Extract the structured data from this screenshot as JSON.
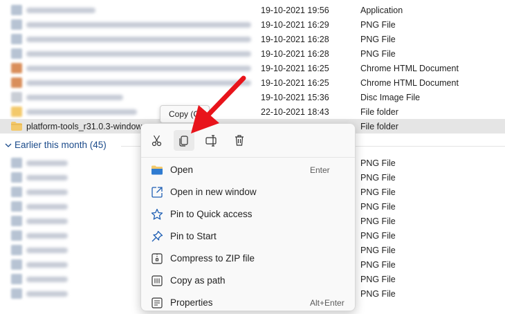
{
  "rows_top": [
    {
      "date": "19-10-2021 19:56",
      "type": "Application",
      "icon_color": "#b7c3d3",
      "text_w": 100
    },
    {
      "date": "19-10-2021 16:29",
      "type": "PNG File",
      "icon_color": "#b7c3d3",
      "text_w": 325
    },
    {
      "date": "19-10-2021 16:28",
      "type": "PNG File",
      "icon_color": "#b7c3d3",
      "text_w": 325
    },
    {
      "date": "19-10-2021 16:28",
      "type": "PNG File",
      "icon_color": "#b7c3d3",
      "text_w": 325
    },
    {
      "date": "19-10-2021 16:25",
      "type": "Chrome HTML Document",
      "icon_color": "#d98e5a",
      "text_w": 325
    },
    {
      "date": "19-10-2021 16:25",
      "type": "Chrome HTML Document",
      "icon_color": "#d98e5a",
      "text_w": 325
    },
    {
      "date": "19-10-2021 15:36",
      "type": "Disc Image File",
      "icon_color": "#c9ced6",
      "text_w": 140
    },
    {
      "date": "22-10-2021 18:43",
      "type": "File folder",
      "icon_color": "#f3c96b",
      "text_w": 160
    }
  ],
  "selected_row": {
    "name": "platform-tools_r31.0.3-windows",
    "type": "File folder"
  },
  "group": {
    "label": "Earlier this month (45)"
  },
  "rows_bottom": [
    {
      "type": "PNG File"
    },
    {
      "type": "PNG File"
    },
    {
      "type": "PNG File"
    },
    {
      "type": "PNG File"
    },
    {
      "type": "PNG File"
    },
    {
      "type": "PNG File"
    },
    {
      "type": "PNG File"
    },
    {
      "type": "PNG File"
    },
    {
      "type": "PNG File"
    },
    {
      "type": "PNG File"
    }
  ],
  "tooltip": {
    "text": "Copy (Ctrl+C)"
  },
  "context_menu": {
    "quick_actions": [
      "cut-icon",
      "copy-icon",
      "rename-icon",
      "delete-icon"
    ],
    "items": [
      {
        "label": "Open",
        "shortcut": "Enter",
        "icon": "folder-open-icon"
      },
      {
        "label": "Open in new window",
        "shortcut": "",
        "icon": "open-new-window-icon"
      },
      {
        "label": "Pin to Quick access",
        "shortcut": "",
        "icon": "star-icon"
      },
      {
        "label": "Pin to Start",
        "shortcut": "",
        "icon": "pin-icon"
      },
      {
        "label": "Compress to ZIP file",
        "shortcut": "",
        "icon": "zip-icon"
      },
      {
        "label": "Copy as path",
        "shortcut": "",
        "icon": "copy-path-icon"
      },
      {
        "label": "Properties",
        "shortcut": "Alt+Enter",
        "icon": "properties-icon"
      }
    ]
  },
  "colors": {
    "accent": "#0067c0",
    "arrow": "#e8141b",
    "folder": "#f3c96b",
    "selected_bg": "#e5e5e5"
  }
}
